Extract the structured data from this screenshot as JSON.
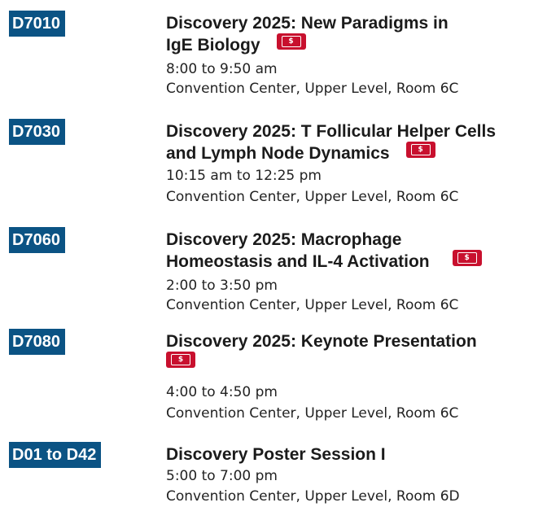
{
  "sessions": [
    {
      "code": "D7010",
      "title": "Discovery 2025: New Paradigms in IgE Biology",
      "title_line1": "Discovery 2025: New Paradigms in",
      "title_line2": "IgE Biology",
      "ticket_label": "$",
      "time": "8:00 to 9:50 am",
      "location": "Convention Center, Upper Level, Room 6C"
    },
    {
      "code": "D7030",
      "title": "Discovery 2025: T Follicular Helper Cells and Lymph Node Dynamics",
      "title_line1": "Discovery 2025: T Follicular Helper Cells",
      "title_line2": "and Lymph Node Dynamics",
      "ticket_label": "$",
      "time": "10:15 am to 12:25 pm",
      "location": "Convention Center, Upper Level, Room 6C"
    },
    {
      "code": "D7060",
      "title": "Discovery 2025: Macrophage Homeostasis and IL-4 Activation",
      "title_line1": "Discovery 2025: Macrophage",
      "title_line2": "Homeostasis and IL-4 Activation",
      "ticket_label": "$",
      "time": "2:00 to 3:50 pm",
      "location": "Convention Center, Upper Level, Room 6C"
    },
    {
      "code": "D7080",
      "title": "Discovery 2025: Keynote Presentation",
      "title_line1": "Discovery 2025: Keynote Presentation",
      "ticket_label": "$",
      "time": "4:00 to 4:50 pm",
      "location": "Convention Center, Upper Level, Room 6C"
    },
    {
      "code": "D01 to D42",
      "title": "Discovery Poster Session I",
      "time": "5:00 to 7:00 pm",
      "location": "Convention Center, Upper Level, Room 6D"
    }
  ],
  "colors": {
    "code_badge_bg": "#0b5384",
    "ticket_bg": "#c8102e"
  },
  "icons": {
    "ticket": "ticket-icon"
  }
}
